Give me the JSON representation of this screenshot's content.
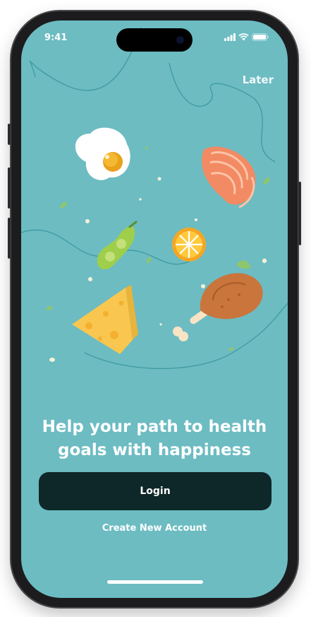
{
  "status_bar": {
    "time": "9:41",
    "icons": [
      "cellular-signal-icon",
      "wifi-icon",
      "battery-icon"
    ]
  },
  "header": {
    "later_label": "Later"
  },
  "illustration": {
    "items": [
      "egg-icon",
      "salmon-icon",
      "edamame-icon",
      "orange-slice-icon",
      "chicken-leg-icon",
      "cheese-icon"
    ]
  },
  "main": {
    "headline_line1": "Help your path to health",
    "headline_line2": "goals with happiness"
  },
  "actions": {
    "login_label": "Login",
    "create_account_label": "Create New Account"
  },
  "colors": {
    "background": "#6cbcc2",
    "button": "#0e2729",
    "text": "#ffffff"
  }
}
